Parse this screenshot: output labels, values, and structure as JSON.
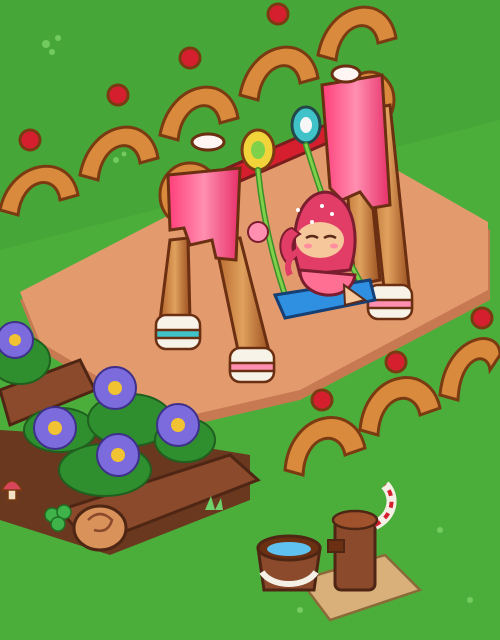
{
  "scene": {
    "type": "isometric cozy game playground tile",
    "items": [
      "pretzel-fence",
      "candy-swing-set",
      "strawberry-cookie-character",
      "flower-bed",
      "water-pump",
      "wooden-bucket",
      "mushroom",
      "clover-plant"
    ]
  },
  "colors": {
    "grass": "#4cae3a",
    "grass_dark": "#3f9c35",
    "dirt": "#e39a6c",
    "dirt_edge": "#c77a52",
    "pretzel": "#d98a3c",
    "pretzel_outline": "#7a3b12",
    "cherry": "#d61f2e",
    "candy_pink": "#ff5a8a",
    "wood": "#a0522d",
    "seat": "#2f8fe0",
    "rope": "#7fd14a",
    "violet": "#7b6bdc",
    "violet_center": "#f1c232",
    "soil_log": "#8b4a2b"
  }
}
